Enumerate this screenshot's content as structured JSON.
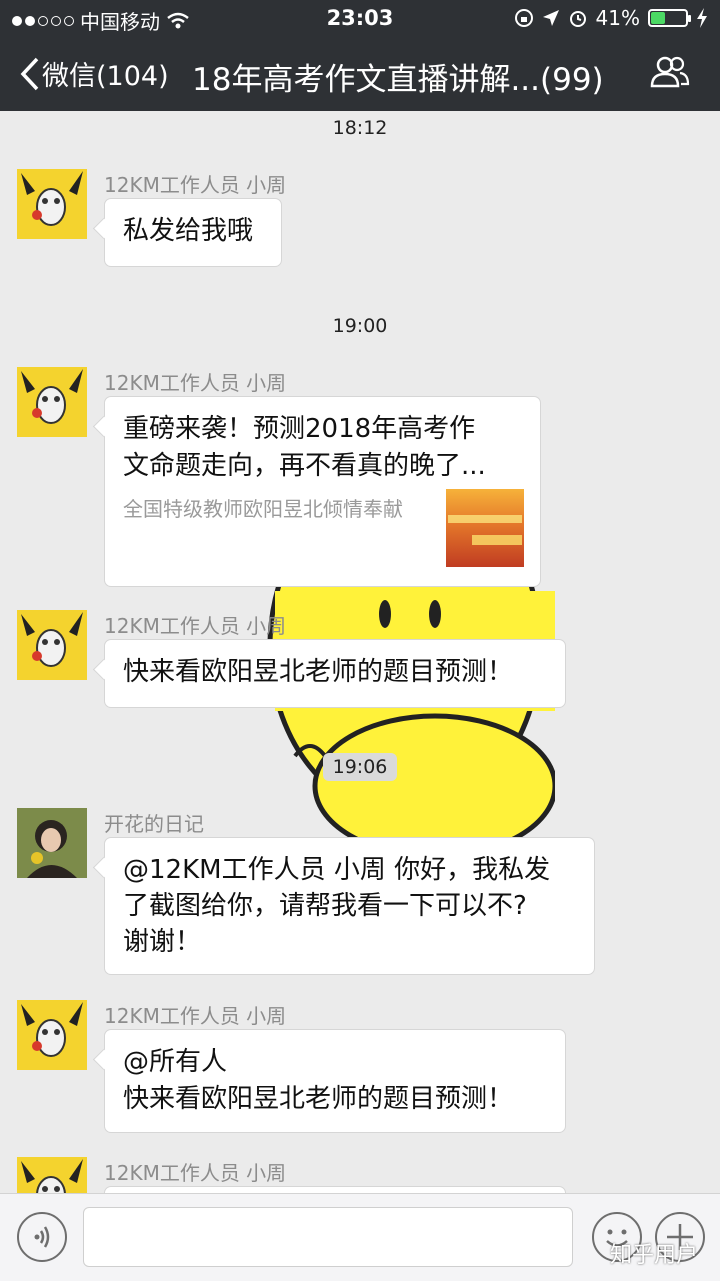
{
  "status_bar": {
    "carrier": "中国移动",
    "time": "23:03",
    "battery": "41%",
    "battery_level": 0.41
  },
  "nav": {
    "back_label": "微信(104)",
    "title": "18年高考作文直播讲解...(99)"
  },
  "messages": [
    {
      "timestamp": "18:12"
    },
    {
      "sender": "12KM工作人员 小周",
      "text": "私发给我哦"
    },
    {
      "timestamp": "19:00"
    },
    {
      "sender": "12KM工作人员 小周",
      "link": {
        "title_line1": "重磅来袭！预测2018年高考作",
        "title_line2": "文命题走向，再不看真的晚了...",
        "description": "全国特级教师欧阳昱北倾情奉献"
      }
    },
    {
      "sender": "12KM工作人员 小周",
      "text": "快来看欧阳昱北老师的题目预测！"
    },
    {
      "timestamp": "19:06"
    },
    {
      "sender": "开花的日记",
      "line1": "@12KM工作人员 小周 你好，我私发",
      "line2": "了截图给你，请帮我看一下可以不?",
      "line3": "谢谢！"
    },
    {
      "sender": "12KM工作人员 小周",
      "line1": "@所有人",
      "line2": "快来看欧阳昱北老师的题目预测！"
    },
    {
      "sender": "12KM工作人员 小周"
    }
  ],
  "watermark": "知乎用户",
  "colors": {
    "nav_bg": "#2e3135",
    "chat_bg": "#ebebeb",
    "bubble_bg": "#ffffff",
    "battery_fill": "#4cd964"
  }
}
